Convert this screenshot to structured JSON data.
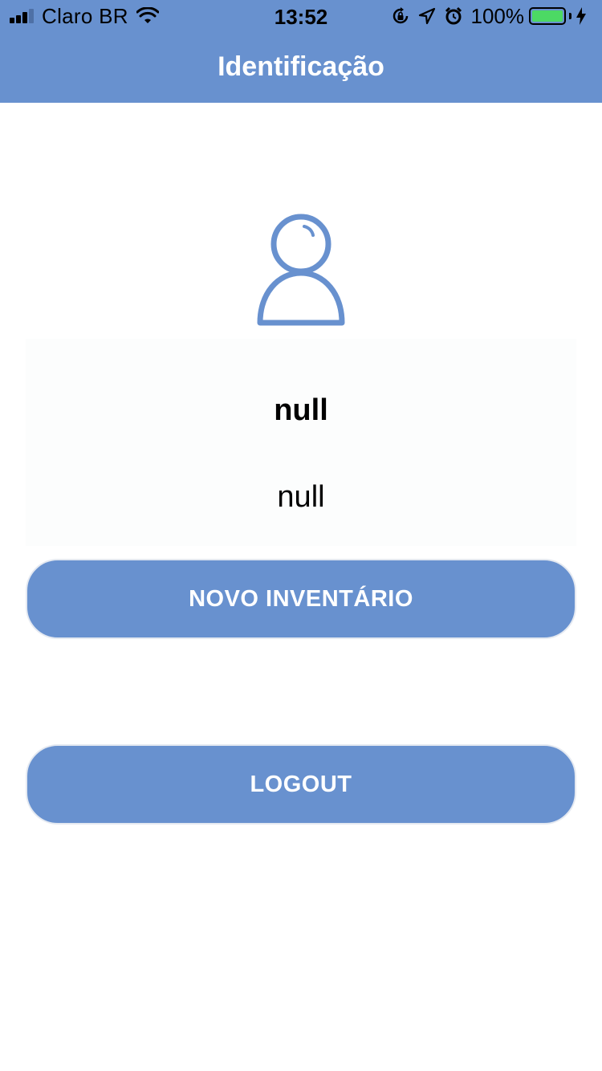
{
  "status_bar": {
    "carrier": "Claro BR",
    "time": "13:52",
    "battery_percent": "100%",
    "battery_level": 1.0
  },
  "nav": {
    "title": "Identificação"
  },
  "profile": {
    "name": "null",
    "detail": "null"
  },
  "actions": {
    "new_inventory_label": "NOVO INVENTÁRIO",
    "logout_label": "LOGOUT"
  },
  "colors": {
    "primary": "#6891cf",
    "battery": "#4cd964",
    "background": "#ffffff"
  }
}
